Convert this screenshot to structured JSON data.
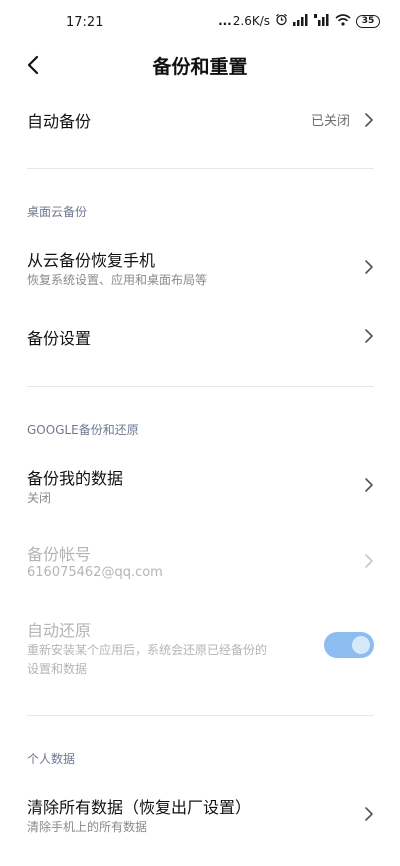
{
  "status_bar": {
    "time": "17:21",
    "dots": "...",
    "net_speed": "2.6K/s",
    "battery": "35"
  },
  "header": {
    "title": "备份和重置"
  },
  "auto_backup": {
    "label": "自动备份",
    "value": "已关闭"
  },
  "cloud_section": {
    "header": "桌面云备份",
    "restore": {
      "label": "从云备份恢复手机",
      "sub": "恢复系统设置、应用和桌面布局等"
    },
    "settings": {
      "label": "备份设置"
    }
  },
  "google_section": {
    "header": "GOOGLE备份和还原",
    "backup_data": {
      "label": "备份我的数据",
      "sub": "关闭"
    },
    "backup_account": {
      "label": "备份帐号",
      "sub": "616075462@qq.com"
    },
    "auto_restore": {
      "label": "自动还原",
      "sub_line1": "重新安装某个应用后，系统会还原已经备份的",
      "sub_line2": "设置和数据",
      "enabled": true
    }
  },
  "personal_section": {
    "header": "个人数据",
    "factory_reset": {
      "label": "清除所有数据（恢复出厂设置）",
      "sub": "清除手机上的所有数据"
    }
  },
  "colors": {
    "toggle_track": "#8cbcf0",
    "section_header": "#6f7891",
    "disabled_text": "#b5b5b5"
  }
}
